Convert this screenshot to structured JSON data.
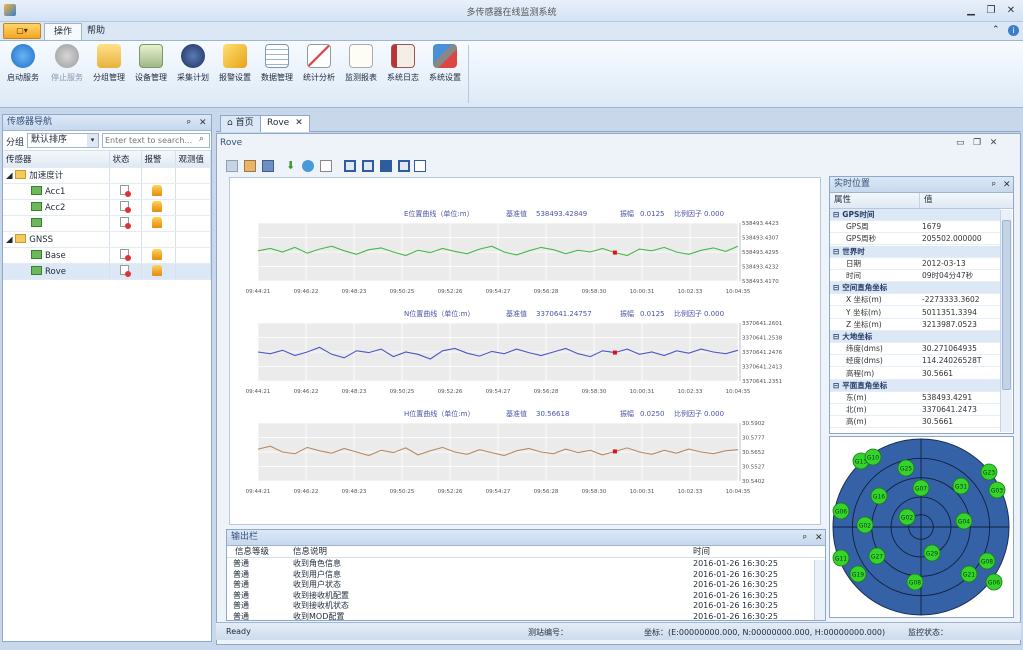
{
  "window": {
    "title": "多传感器在线监测系统"
  },
  "tabs": [
    "操作",
    "帮助"
  ],
  "menu_label": "▢▾",
  "ribbon": [
    "启动服务",
    "停止服务",
    "分组管理",
    "设备管理",
    "采集计划",
    "报警设置",
    "数据管理",
    "统计分析",
    "监测报表",
    "系统日志",
    "系统设置"
  ],
  "nav": {
    "title": "传感器导航",
    "group_label": "分组",
    "sort_value": "默认排序",
    "search_placeholder": "Enter text to search...",
    "columns": [
      "传感器",
      "状态",
      "报警",
      "观测值"
    ],
    "tree": [
      {
        "label": "加速度计",
        "kind": "group"
      },
      {
        "label": "Acc1",
        "kind": "sensor"
      },
      {
        "label": "Acc2",
        "kind": "sensor"
      },
      {
        "label": "",
        "kind": "sensor"
      },
      {
        "label": "GNSS",
        "kind": "group"
      },
      {
        "label": "Base",
        "kind": "sensor"
      },
      {
        "label": "Rove",
        "kind": "sensor"
      }
    ]
  },
  "doc_tabs": [
    "首页",
    "Rove"
  ],
  "doc_title": "Rove",
  "charts": [
    {
      "title": "E位置曲线（单位:m）",
      "base_label": "基准值",
      "base": "538493.42849",
      "amp_label": "振幅",
      "amp": "0.0125",
      "scale_label": "比例因子",
      "scale": "0.000",
      "color": "#46b84a",
      "yticks": [
        "538493.4423",
        "538493.4307",
        "538493.4295",
        "538493.4232",
        "538493.4170"
      ],
      "values": [
        0.52,
        0.56,
        0.5,
        0.58,
        0.48,
        0.55,
        0.6,
        0.52,
        0.46,
        0.54,
        0.57,
        0.5,
        0.44,
        0.53,
        0.49,
        0.56,
        0.51,
        0.47,
        0.55,
        0.6,
        0.5,
        0.45,
        0.52,
        0.58,
        0.54,
        0.47,
        0.53,
        0.5,
        0.56,
        0.49,
        0.44,
        0.55,
        0.52,
        0.58,
        0.5,
        0.46,
        0.53,
        0.57,
        0.51,
        0.6
      ]
    },
    {
      "title": "N位置曲线（单位:m）",
      "base_label": "基准值",
      "base": "3370641.24757",
      "amp_label": "振幅",
      "amp": "0.0125",
      "scale_label": "比例因子",
      "scale": "0.000",
      "color": "#4b55c8",
      "yticks": [
        "3370641.2601",
        "3370641.2538",
        "3370641.2476",
        "3370641.2413",
        "3370641.2351"
      ],
      "values": [
        0.5,
        0.47,
        0.53,
        0.44,
        0.5,
        0.58,
        0.46,
        0.4,
        0.52,
        0.49,
        0.55,
        0.42,
        0.5,
        0.46,
        0.38,
        0.52,
        0.56,
        0.48,
        0.43,
        0.51,
        0.47,
        0.55,
        0.49,
        0.44,
        0.5,
        0.56,
        0.47,
        0.42,
        0.52,
        0.49,
        0.55,
        0.46,
        0.5,
        0.44,
        0.52,
        0.48,
        0.55,
        0.5,
        0.47,
        0.53
      ]
    },
    {
      "title": "H位置曲线（单位:m）",
      "base_label": "基准值",
      "base": "30.56618",
      "amp_label": "振幅",
      "amp": "0.0250",
      "scale_label": "比例因子",
      "scale": "0.000",
      "color": "#b88a62",
      "yticks": [
        "30.5902",
        "30.5777",
        "30.5652",
        "30.5527",
        "30.5402"
      ],
      "values": [
        0.55,
        0.6,
        0.5,
        0.47,
        0.58,
        0.52,
        0.48,
        0.56,
        0.5,
        0.44,
        0.53,
        0.49,
        0.57,
        0.45,
        0.52,
        0.58,
        0.5,
        0.46,
        0.54,
        0.49,
        0.44,
        0.52,
        0.56,
        0.5,
        0.47,
        0.55,
        0.49,
        0.53,
        0.45,
        0.51,
        0.57,
        0.5,
        0.46,
        0.53,
        0.48,
        0.55,
        0.5,
        0.47,
        0.52,
        0.54
      ]
    }
  ],
  "xticks": [
    "09:44:21",
    "09:46:22",
    "09:48:23",
    "09:50:25",
    "09:52:26",
    "09:54:27",
    "09:56:28",
    "09:58:30",
    "10:00:31",
    "10:02:33",
    "10:04:35"
  ],
  "realtime": {
    "title": "实时位置",
    "columns": [
      "属性",
      "值"
    ],
    "rows": [
      {
        "s": "GPS时间"
      },
      {
        "k": "GPS周",
        "v": "1679"
      },
      {
        "k": "GPS周秒",
        "v": "205502.000000"
      },
      {
        "s": "世界时"
      },
      {
        "k": "日期",
        "v": "2012-03-13"
      },
      {
        "k": "时间",
        "v": "09时04分47秒"
      },
      {
        "s": "空间直角坐标"
      },
      {
        "k": "X 坐标(m)",
        "v": "-2273333.3602"
      },
      {
        "k": "Y 坐标(m)",
        "v": "5011351.3394"
      },
      {
        "k": "Z 坐标(m)",
        "v": "3213987.0523"
      },
      {
        "s": "大地坐标"
      },
      {
        "k": "纬度(dms)",
        "v": "30.271064935"
      },
      {
        "k": "经度(dms)",
        "v": "114.24026528T"
      },
      {
        "k": "高程(m)",
        "v": "30.5661"
      },
      {
        "s": "平面直角坐标"
      },
      {
        "k": "东(m)",
        "v": "538493.4291"
      },
      {
        "k": "北(m)",
        "v": "3370641.2473"
      },
      {
        "k": "高(m)",
        "v": "30.5661"
      }
    ]
  },
  "satellites": [
    "G13",
    "G10",
    "G25",
    "G23",
    "G07",
    "G31",
    "G16",
    "G03",
    "G06",
    "G02",
    "G02",
    "G04",
    "G11",
    "G27",
    "G29",
    "G08",
    "G21",
    "G08",
    "G19",
    "G06"
  ],
  "output": {
    "title": "输出栏",
    "columns": [
      "信息等级",
      "信息说明",
      "时间"
    ],
    "rows": [
      [
        "普通",
        "收到角色信息",
        "2016-01-26  16:30:25"
      ],
      [
        "普通",
        "收到用户信息",
        "2016-01-26  16:30:25"
      ],
      [
        "普通",
        "收到用户状态",
        "2016-01-26  16:30:25"
      ],
      [
        "普通",
        "收到接收机配置",
        "2016-01-26  16:30:25"
      ],
      [
        "普通",
        "收到接收机状态",
        "2016-01-26  16:30:25"
      ],
      [
        "普通",
        "收到MOD配置",
        "2016-01-26  16:30:25"
      ]
    ]
  },
  "status": {
    "ready": "Ready",
    "station": "测站编号：",
    "coord": "坐标：(E:00000000.000, N:00000000.000, H:00000000.000)",
    "monitor": "监控状态："
  }
}
